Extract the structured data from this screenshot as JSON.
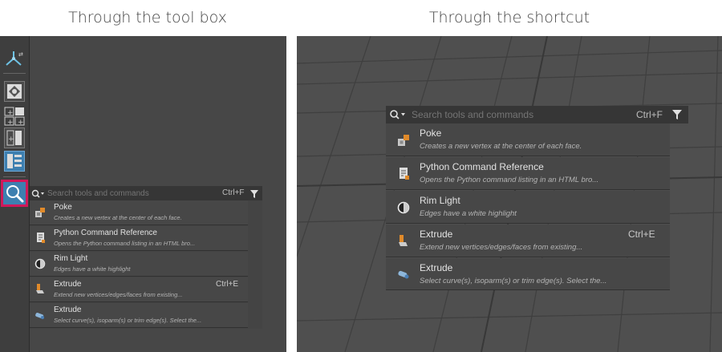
{
  "captions": {
    "left": "Through the tool box",
    "right": "Through the shortcut"
  },
  "search": {
    "placeholder": "Search tools and commands",
    "shortcut": "Ctrl+F"
  },
  "results": [
    {
      "title": "Poke",
      "description": "Creates a new vertex at the center of each face.",
      "shortcut": "",
      "icon": "poke-icon"
    },
    {
      "title": "Python Command Reference",
      "description": "Opens the Python command listing in an HTML bro...",
      "shortcut": "",
      "icon": "document-icon"
    },
    {
      "title": "Rim Light",
      "description": "Edges have a white highlight",
      "shortcut": "",
      "icon": "rim-light-icon"
    },
    {
      "title": "Extrude",
      "description": "Extend new vertices/edges/faces from existing...",
      "shortcut": "Ctrl+E",
      "icon": "extrude-icon"
    },
    {
      "title": "Extrude",
      "description": "Select curve(s), isoparm(s) or trim edge(s).  Select the...",
      "shortcut": "",
      "icon": "extrude-curve-icon"
    }
  ],
  "colors": {
    "highlight_border": "#d0185a",
    "active_tool": "#3d7fb0",
    "accent_orange": "#e08a2a"
  }
}
